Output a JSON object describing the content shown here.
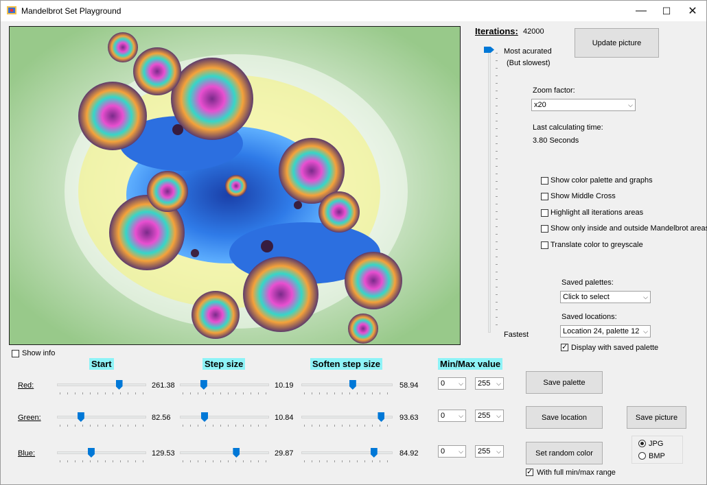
{
  "window": {
    "title": "Mandelbrot Set Playground",
    "minimize_glyph": "—",
    "maximize_glyph": "☐",
    "close_glyph": "✕"
  },
  "iterations": {
    "label": "Iterations:",
    "value": "42000",
    "top_label": "Most acurated",
    "top_sublabel": "(But slowest)",
    "bottom_label": "Fastest",
    "level": 1.0
  },
  "buttons": {
    "update_picture": "Update picture",
    "save_palette": "Save  palette",
    "save_location": "Save location",
    "save_picture": "Save picture",
    "set_random_color": "Set random color"
  },
  "zoom": {
    "label": "Zoom factor:",
    "value": "x20"
  },
  "calc_time": {
    "label": "Last calculating time:",
    "value": "3.80 Seconds"
  },
  "options": [
    {
      "label": "Show color palette and graphs",
      "checked": false
    },
    {
      "label": "Show Middle Cross",
      "checked": false
    },
    {
      "label": "Highlight all iterations areas",
      "checked": false
    },
    {
      "label": "Show only inside and outside Mandelbrot areas",
      "checked": false
    },
    {
      "label": "Translate color to greyscale",
      "checked": false
    }
  ],
  "saved_palettes": {
    "label": "Saved palettes:",
    "value": "Click to select"
  },
  "saved_locations": {
    "label": "Saved locations:",
    "value": "Location 24, palette 12"
  },
  "display_saved_palette": {
    "label": "Display with saved palette",
    "checked": true
  },
  "show_info": {
    "label": "Show info",
    "checked": false
  },
  "headers": {
    "start": "Start",
    "step": "Step size",
    "soften": "Soften step size",
    "minmax": "Min/Max value"
  },
  "channels": [
    {
      "name": "Red:",
      "start": "261.38",
      "start_frac": 0.72,
      "step": "10.19",
      "step_frac": 0.24,
      "soften": "58.94",
      "soften_frac": 0.57,
      "min": "0",
      "max": "255"
    },
    {
      "name": "Green:",
      "start": "82.56",
      "start_frac": 0.24,
      "step": "10.84",
      "step_frac": 0.25,
      "soften": "93.63",
      "soften_frac": 0.92,
      "min": "0",
      "max": "255"
    },
    {
      "name": "Blue:",
      "start": "129.53",
      "start_frac": 0.37,
      "step": "29.87",
      "step_frac": 0.65,
      "soften": "84.92",
      "soften_frac": 0.83,
      "min": "0",
      "max": "255"
    }
  ],
  "full_range": {
    "label": "With full min/max range",
    "checked": true
  },
  "format": [
    {
      "label": "JPG",
      "selected": true
    },
    {
      "label": "BMP",
      "selected": false
    }
  ],
  "icons": {
    "app": "app-icon",
    "combo_arrow": "chevron-down-icon"
  }
}
